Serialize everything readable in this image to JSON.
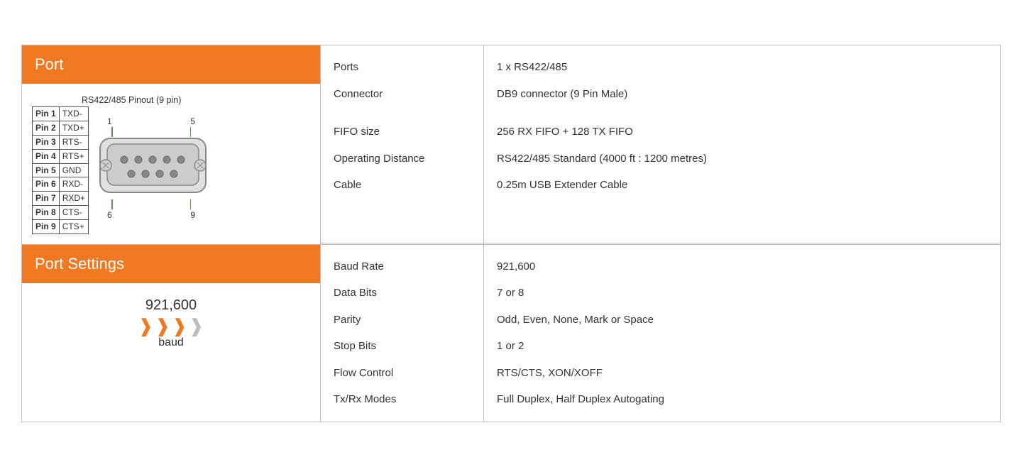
{
  "port_section": {
    "header": "Port",
    "pinout_title": "RS422/485 Pinout (9 pin)",
    "pin_numbers_top": [
      "1",
      "5"
    ],
    "pin_numbers_bottom": [
      "6",
      "9"
    ],
    "pins": [
      {
        "label": "Pin 1",
        "signal": "TXD-"
      },
      {
        "label": "Pin 2",
        "signal": "TXD+"
      },
      {
        "label": "Pin 3",
        "signal": "RTS-"
      },
      {
        "label": "Pin 4",
        "signal": "RTS+"
      },
      {
        "label": "Pin 5",
        "signal": "GND"
      },
      {
        "label": "Pin 6",
        "signal": "RXD-"
      },
      {
        "label": "Pin 7",
        "signal": "RXD+"
      },
      {
        "label": "Pin 8",
        "signal": "CTS-"
      },
      {
        "label": "Pin 9",
        "signal": "CTS+"
      }
    ],
    "specs": [
      {
        "label": "Ports",
        "value": "1 x RS422/485"
      },
      {
        "label": "Connector",
        "value": "DB9 connector (9 Pin Male)"
      },
      {
        "label": "FIFO size",
        "value": "256 RX FIFO + 128 TX FIFO"
      },
      {
        "label": "Operating Distance",
        "value": "RS422/485 Standard (4000 ft : 1200 metres)"
      },
      {
        "label": "Cable",
        "value": "0.25m USB Extender Cable"
      }
    ]
  },
  "port_settings_section": {
    "header": "Port Settings",
    "baud_number": "921,600",
    "baud_label": "baud",
    "specs": [
      {
        "label": "Baud Rate",
        "value": "921,600"
      },
      {
        "label": "Data Bits",
        "value": "7 or 8"
      },
      {
        "label": "Parity",
        "value": "Odd, Even, None, Mark or Space"
      },
      {
        "label": "Stop Bits",
        "value": "1 or 2"
      },
      {
        "label": "Flow Control",
        "value": "RTS/CTS, XON/XOFF"
      },
      {
        "label": "Tx/Rx Modes",
        "value": "Full Duplex, Half Duplex Autogating"
      }
    ]
  },
  "colors": {
    "orange": "#f07820",
    "border": "#bbb",
    "text": "#333",
    "white": "#fff"
  }
}
